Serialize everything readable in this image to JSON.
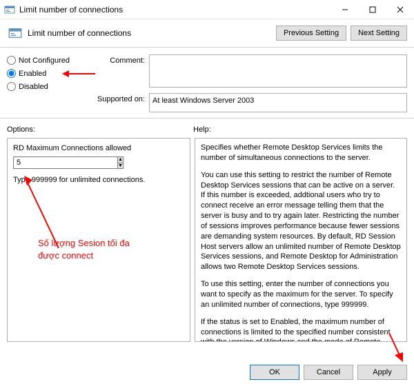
{
  "window": {
    "title": "Limit number of connections",
    "header_title": "Limit number of connections"
  },
  "nav": {
    "previous": "Previous Setting",
    "next": "Next Setting"
  },
  "state": {
    "not_configured": "Not Configured",
    "enabled": "Enabled",
    "disabled": "Disabled",
    "selected": "enabled"
  },
  "comment": {
    "label": "Comment:",
    "value": ""
  },
  "supported": {
    "label": "Supported on:",
    "value": "At least Windows Server 2003"
  },
  "labels": {
    "options": "Options:",
    "help": "Help:"
  },
  "options": {
    "title": "RD Maximum Connections allowed",
    "value": "5",
    "note": "Type 999999 for unlimited connections."
  },
  "help": {
    "p1": "Specifies whether Remote Desktop Services limits the number of simultaneous connections to the server.",
    "p2": "You can use this setting to restrict the number of Remote Desktop Services sessions that can be active on a server. If this number is exceeded, addtional users who try to connect receive an error message telling them that the server is busy and to try again later. Restricting the number of sessions improves performance because fewer sessions are demanding system resources. By default, RD Session Host servers allow an unlimited number of Remote Desktop Services sessions, and Remote Desktop for Administration allows two Remote Desktop Services sessions.",
    "p3": "To use this setting, enter the number of connections you want to specify as the maximum for the server. To specify an unlimited number of connections, type 999999.",
    "p4": "If the status is set to Enabled, the maximum number of connections is limited to the specified number consistent with the version of Windows and the mode of Remote Desktop"
  },
  "buttons": {
    "ok": "OK",
    "cancel": "Cancel",
    "apply": "Apply"
  },
  "annotations": {
    "text": "Số lượng Sesion tối đa\nđược connect"
  }
}
